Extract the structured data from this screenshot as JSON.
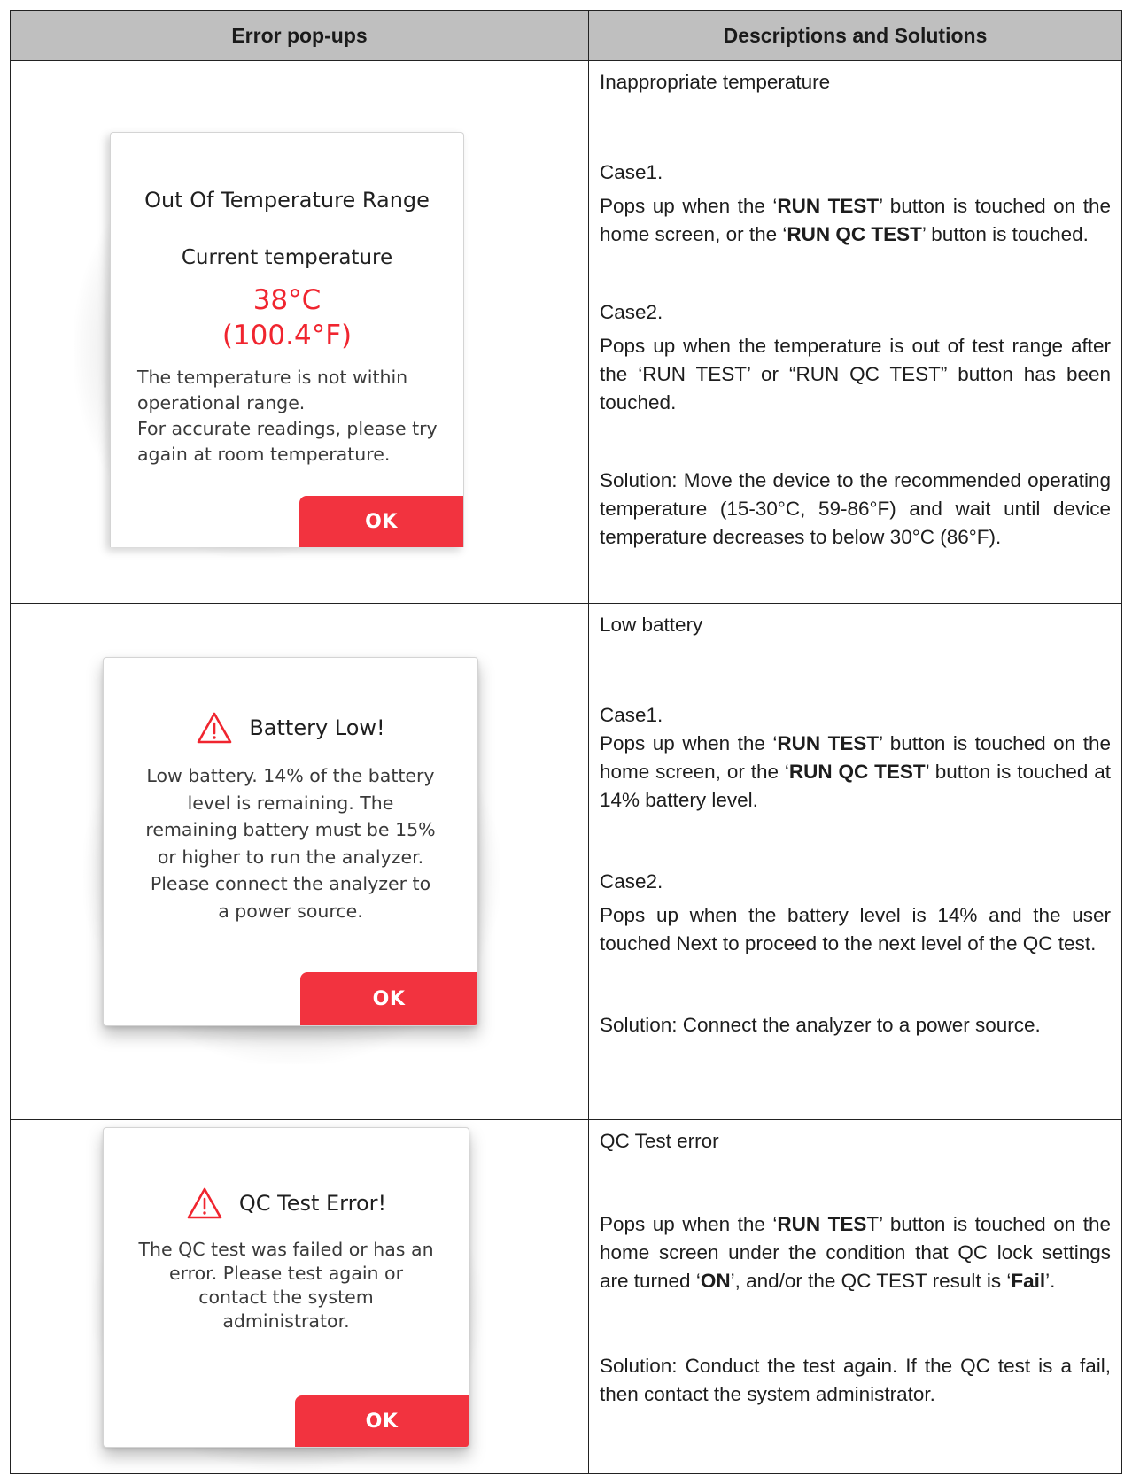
{
  "table": {
    "headers": {
      "left": "Error pop-ups",
      "right": "Descriptions and Solutions"
    },
    "rows": [
      {
        "popup": {
          "title": "Out Of Temperature Range",
          "subtitle": "Current temperature",
          "temp_c": "38°C",
          "temp_f": "(100.4°F)",
          "body_lines": [
            "The temperature is not within",
            "operational range.",
            "For accurate readings, please try",
            "again at room temperature."
          ],
          "ok": "OK"
        },
        "desc": {
          "heading": "Inappropriate temperature",
          "case1_label": "Case1.",
          "case1_t1": "Pops up when the ‘",
          "case1_b1": "RUN TEST",
          "case1_t2": "’ button is touched on the home screen, or the ‘",
          "case1_b2": "RUN QC TEST",
          "case1_t3": "’ button is touched.",
          "case2_label": "Case2.",
          "case2_text": "Pops up when the temperature is out of test range after the ‘RUN TEST’ or “RUN QC TEST” button has been touched.",
          "solution": "Solution: Move the device to the recommended operating temperature (15-30°C, 59-86°F) and wait until device temperature decreases to below 30°C (86°F)."
        }
      },
      {
        "popup": {
          "title": "Battery Low!",
          "icon": "warning-triangle-icon",
          "body_lines": [
            "Low battery. 14% of the battery",
            "level is remaining. The",
            "remaining battery must be 15%",
            "or higher to run the analyzer.",
            "Please connect the analyzer to",
            "a power source."
          ],
          "ok": "OK"
        },
        "desc": {
          "heading": "Low battery",
          "case1_label": "Case1.",
          "case1_t1": "Pops up when the ‘",
          "case1_b1": "RUN TEST",
          "case1_t2": "’ button is touched on the home screen, or the ‘",
          "case1_b2": "RUN QC TEST",
          "case1_t3": "’ button is touched at 14% battery level.",
          "case2_label": "Case2.",
          "case2_text": "Pops up when the battery level is 14% and the user touched Next to proceed to the next level of the QC test.",
          "solution": "Solution: Connect the analyzer to a power source."
        }
      },
      {
        "popup": {
          "title": "QC Test Error!",
          "icon": "warning-triangle-icon",
          "body_lines": [
            "The QC test was failed or has an",
            "error. Please test again or",
            "contact the system",
            "administrator."
          ],
          "ok": "OK"
        },
        "desc": {
          "heading": "QC Test error",
          "t1": "Pops up when the ‘",
          "b1": "RUN TES",
          "t2": "T’ button is touched on the home screen under the condition that QC lock settings are turned ‘",
          "b2": "ON",
          "t3": "’, and/or the QC TEST result is ‘",
          "b3": "Fail",
          "t4": "’.",
          "solution": "Solution: Conduct the test again. If the QC test is a fail, then contact the system administrator."
        }
      }
    ]
  },
  "colors": {
    "accent_red": "#f2333f",
    "header_gray": "#bfbfbf"
  }
}
